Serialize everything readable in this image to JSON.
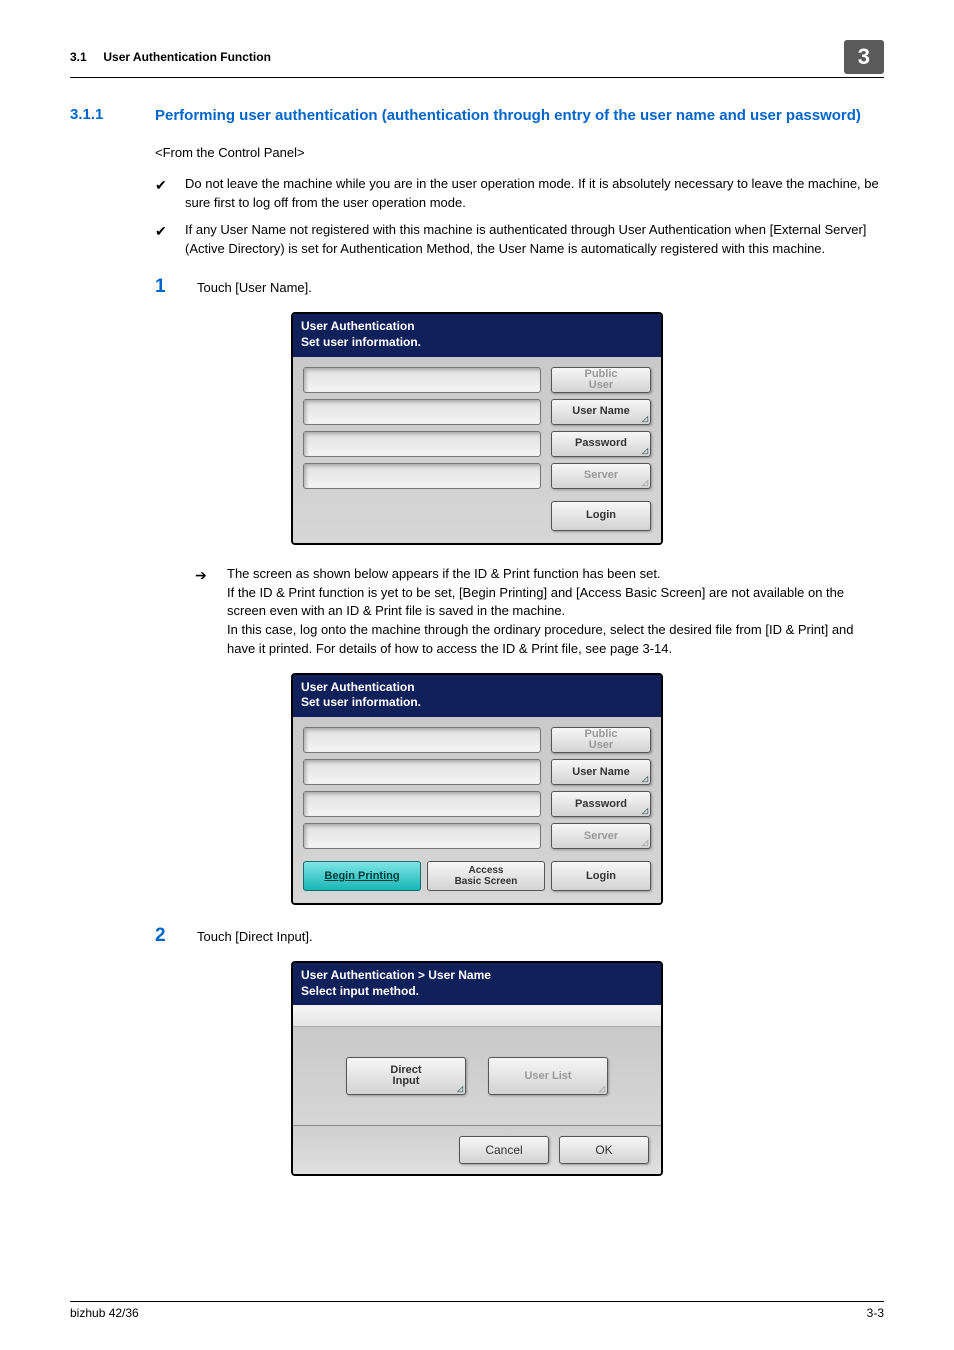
{
  "header": {
    "section_ref": "3.1",
    "section_title": "User Authentication Function",
    "chapter": "3"
  },
  "section": {
    "number": "3.1.1",
    "title": "Performing user authentication (authentication through entry of the user name and user password)"
  },
  "subhead": "<From the Control Panel>",
  "bullets": [
    "Do not leave the machine while you are in the user operation mode. If it is absolutely necessary to leave the machine, be sure first to log off from the user operation mode.",
    "If any User Name not registered with this machine is authenticated through User Authentication when [External Server] (Active Directory) is set for Authentication Method, the User Name is automatically registered with this machine."
  ],
  "steps": {
    "one": {
      "num": "1",
      "text": "Touch [User Name]."
    },
    "two": {
      "num": "2",
      "text": "Touch [Direct Input]."
    }
  },
  "arrow_block": "The screen as shown below appears if the ID & Print function has been set.\nIf the ID & Print function is yet to be set, [Begin Printing] and [Access Basic Screen] are not available on the screen even with an ID & Print file is saved in the machine.\nIn this case, log onto the machine through the ordinary procedure, select the desired file from [ID & Print] and have it printed. For details of how to access the ID & Print file, see page 3-14.",
  "panel1": {
    "title_line1": "User Authentication",
    "title_line2": "Set user information.",
    "buttons": {
      "public_user": "Public\nUser",
      "user_name": "User Name",
      "password": "Password",
      "server": "Server",
      "login": "Login"
    }
  },
  "panel2": {
    "title_line1": "User Authentication",
    "title_line2": "Set user information.",
    "buttons": {
      "public_user": "Public\nUser",
      "user_name": "User Name",
      "password": "Password",
      "server": "Server",
      "begin_printing": "Begin Printing",
      "access_basic": "Access\nBasic Screen",
      "login": "Login"
    }
  },
  "panel3": {
    "title_line1": "User Authentication > User Name",
    "title_line2": "Select input method.",
    "buttons": {
      "direct_input": "Direct\nInput",
      "user_list": "User List",
      "cancel": "Cancel",
      "ok": "OK"
    }
  },
  "footer": {
    "left": "bizhub 42/36",
    "right": "3-3"
  }
}
